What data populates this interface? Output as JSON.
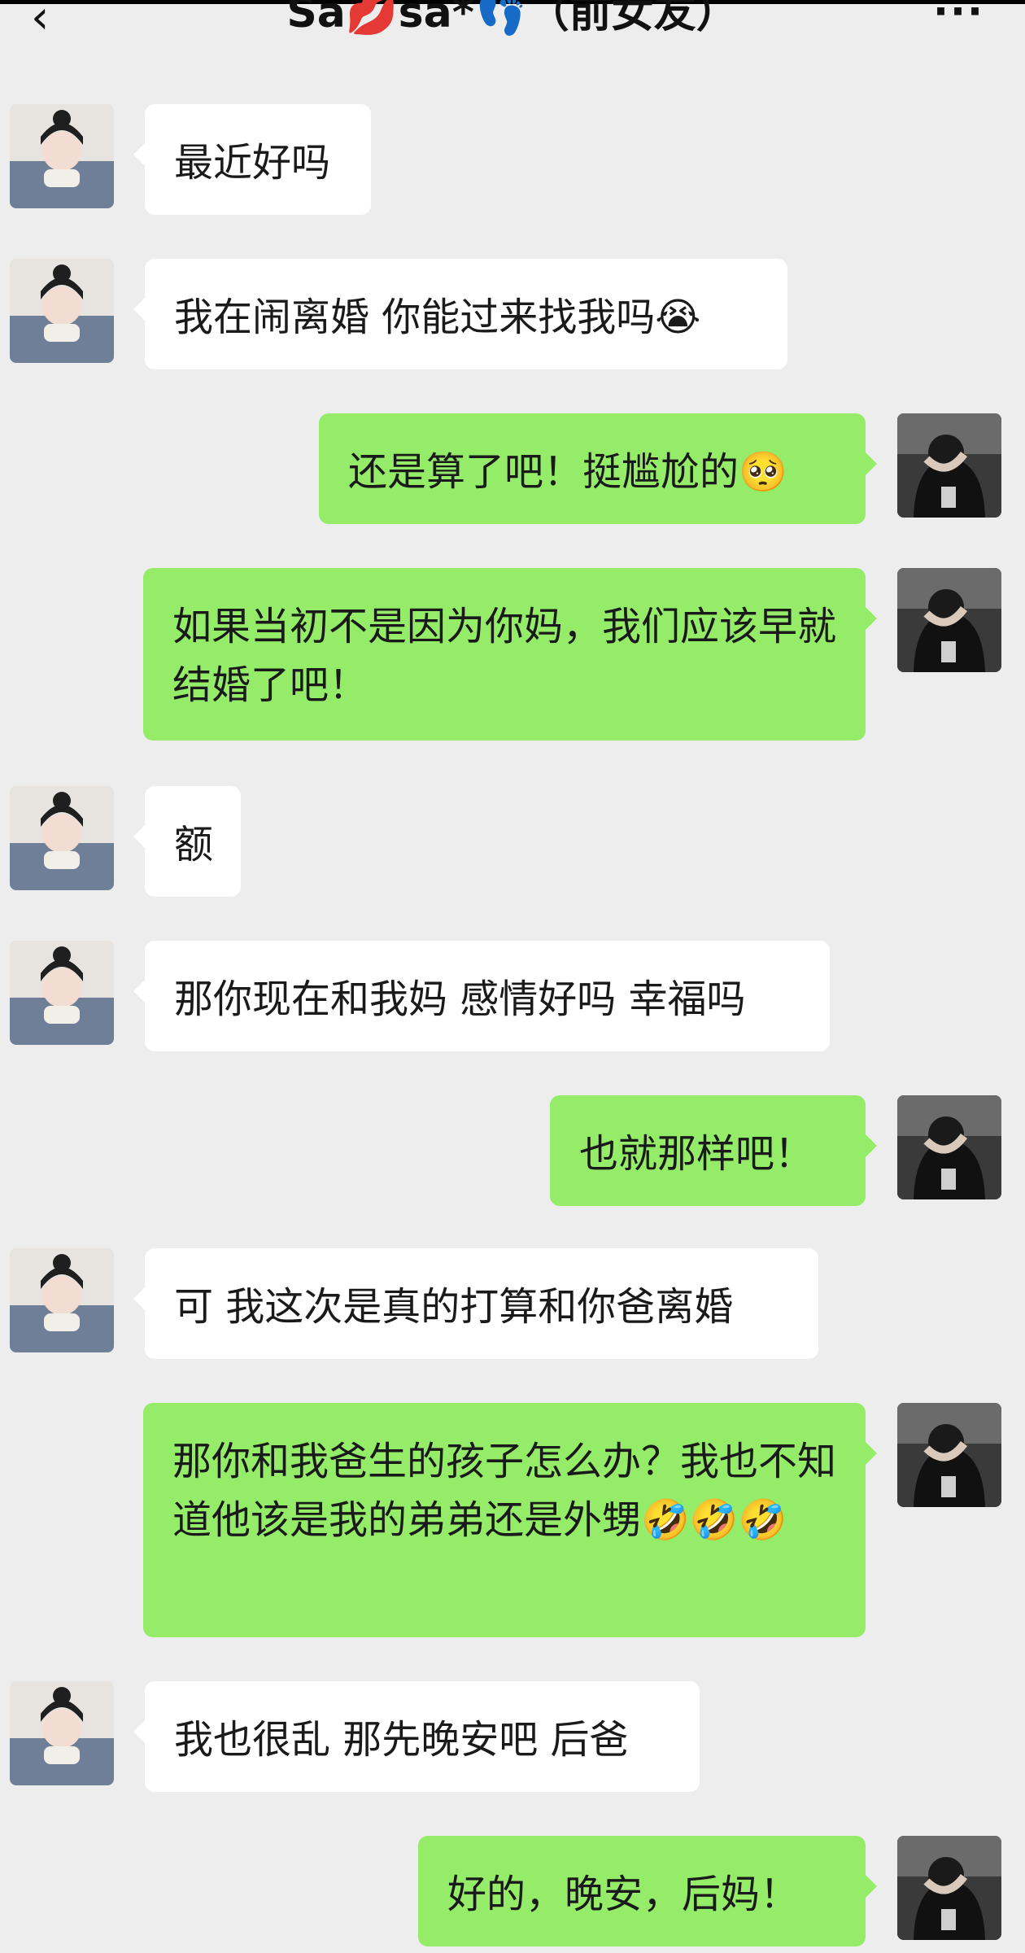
{
  "header": {
    "back_icon": "chevron-left-icon",
    "title": "Sa💋sa*👣（前女友）",
    "more_icon": "more-dots-icon"
  },
  "colors": {
    "background": "#ededed",
    "her_bubble": "#ffffff",
    "my_bubble": "#95ec69"
  },
  "messages": [
    {
      "sender": "her",
      "text": "最近好吗"
    },
    {
      "sender": "her",
      "text": "我在闹离婚 你能过来找我吗😭"
    },
    {
      "sender": "me",
      "text": "还是算了吧！挺尴尬的🥺"
    },
    {
      "sender": "me",
      "text": "如果当初不是因为你妈，我们应该早就结婚了吧！"
    },
    {
      "sender": "her",
      "text": "额"
    },
    {
      "sender": "her",
      "text": "那你现在和我妈 感情好吗 幸福吗"
    },
    {
      "sender": "me",
      "text": "也就那样吧！"
    },
    {
      "sender": "her",
      "text": "可 我这次是真的打算和你爸离婚"
    },
    {
      "sender": "me",
      "text": "那你和我爸生的孩子怎么办？我也不知道他该是我的弟弟还是外甥🤣🤣🤣"
    },
    {
      "sender": "her",
      "text": "我也很乱 那先晚安吧 后爸"
    },
    {
      "sender": "me",
      "text": "好的，晚安，后妈！"
    }
  ]
}
